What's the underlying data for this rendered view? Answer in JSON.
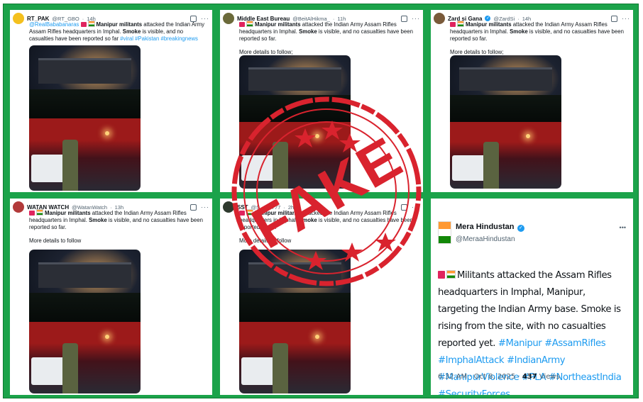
{
  "tweets": [
    {
      "name": "RT_PAK",
      "handle": "@RT_GBO",
      "time": "14h",
      "mention": "@RealBababanaras",
      "headline": "Manipur militants",
      "text1": " attacked the Indian Army Assam Rifles headquarters in Imphal. ",
      "bold2": "Smoke",
      "text2": " is visible, and no casualties have been reported so far ",
      "hashtags": "#viral #Pakistan #breakingnews",
      "more": "",
      "avatar_color": "#f4c01e"
    },
    {
      "name": "Middle East Bureau",
      "handle": "@BeitAlHikma_",
      "time": "11h",
      "headline": "Manipur militants",
      "text1": " attacked the Indian Army Assam Rifles headquarters in Imphal. ",
      "bold2": "Smoke",
      "text2": " is visible, and no casualties have been reported so far.",
      "more": "More details to follow;",
      "avatar_color": "#6b6a3a"
    },
    {
      "name": "Zard si Gana",
      "handle": "@ZardSi",
      "time": "14h",
      "headline": "Manipur militants",
      "text1": " attacked the Indian Army Assam Rifles headquarters in Imphal. ",
      "bold2": "Smoke",
      "text2": " is visible, and no casualties have been reported so far.",
      "more": "More details to follow;",
      "avatar_color": "#7a5a3a"
    },
    {
      "name": "WATAN WATCH",
      "handle": "@WatanWatch",
      "time": "13h",
      "headline": "Manipur militants",
      "text1": " attacked the Indian Army Assam Rifles headquarters in Imphal. ",
      "bold2": "Smoke",
      "text2": " is visible, and no casualties have been reported so far.",
      "more": "More details to follow",
      "avatar_color": "#b23a3a"
    },
    {
      "name": "SST",
      "handle": "@S___n777",
      "time": "2h",
      "headline": "Manipur militants",
      "text1": " attacked the Indian Army Assam Rifles headquarters in Imphal. ",
      "bold2": "Smoke",
      "text2": " is visible, and no casualties have been reported so far.",
      "more": "More details to follow",
      "avatar_color": "#2e3a2e"
    }
  ],
  "mera": {
    "name": "Mera Hindustan",
    "handle": "@MeraaHindustan",
    "text": "Militants attacked the Assam Rifles headquarters in Imphal, Manipur, targeting the Indian Army base. Smoke is rising from the site, with no casualties reported yet. ",
    "hashtags": "#Manipur #AssamRifles #ImphalAttack #IndianArmy #ManipurViolence #PLA #NortheastIndia #SecurityForces",
    "time": "6:32 AM · Oct 8, 2025 · ",
    "views_count": "437",
    "views_label": " Views"
  },
  "stamp": {
    "label": "FAKE",
    "color": "#d9232e"
  },
  "icons": {
    "more": "more-horizontal-icon",
    "grok": "grok-icon",
    "verified": "verified-badge-icon"
  }
}
